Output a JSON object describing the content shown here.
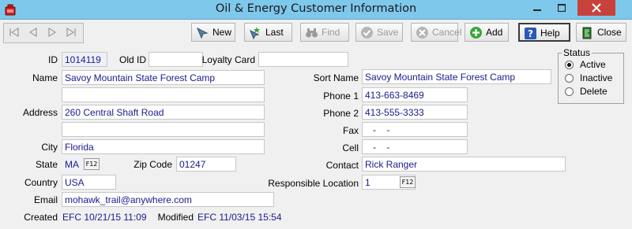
{
  "window": {
    "title": "Oil & Energy Customer Information"
  },
  "toolbar": {
    "new_label": "New",
    "last_label": "Last",
    "find_label": "Find",
    "save_label": "Save",
    "cancel_label": "Cancel",
    "add_label": "Add",
    "help_label": "Help",
    "close_label": "Close"
  },
  "labels": {
    "id": "ID",
    "old_id": "Old ID",
    "loyalty_card": "Loyalty Card",
    "name": "Name",
    "address": "Address",
    "city": "City",
    "state": "State",
    "zip_code": "Zip Code",
    "country": "Country",
    "email": "Email",
    "created": "Created",
    "modified": "Modified",
    "sort_name": "Sort Name",
    "phone1": "Phone 1",
    "phone2": "Phone 2",
    "fax": "Fax",
    "cell": "Cell",
    "contact": "Contact",
    "responsible_location": "Responsible Location",
    "f12": "F12"
  },
  "fields": {
    "id": "1014119",
    "old_id": "",
    "loyalty_card": "",
    "name": "Savoy Mountain State Forest Camp",
    "name2": "",
    "address": "260 Central Shaft Road",
    "address2": "",
    "city": "Florida",
    "state": "MA",
    "zip_code": "01247",
    "country": "USA",
    "email": "mohawk_trail@anywhere.com",
    "sort_name": "Savoy Mountain State Forest Camp",
    "phone1": "413-663-8469",
    "phone2": "413-555-3333",
    "fax": "   -    -",
    "cell": "   -    -",
    "contact": "Rick Ranger",
    "responsible_location": "1"
  },
  "audit": {
    "created": "EFC 10/21/15 11:09",
    "modified": "EFC 11/03/15 15:54"
  },
  "status": {
    "title": "Status",
    "options": [
      "Active",
      "Inactive",
      "Delete"
    ],
    "selected": "Active"
  },
  "colors": {
    "titlebar": "#7ec8ec",
    "close_button": "#c8423b",
    "field_text": "#1a1a8c",
    "readonly_field": "#eef0f7"
  }
}
